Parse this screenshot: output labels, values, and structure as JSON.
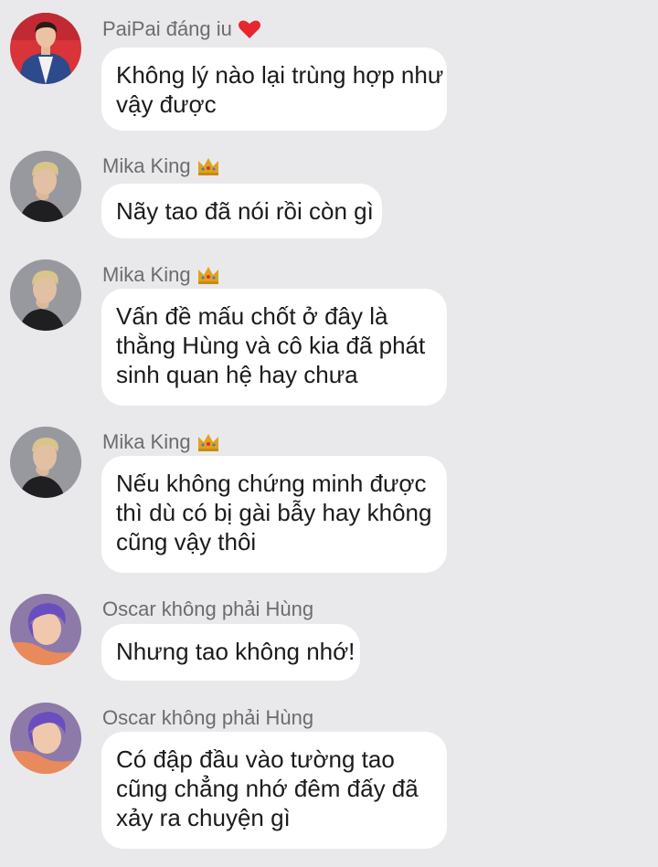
{
  "messages": [
    {
      "sender": "PaiPai đáng iu",
      "sender_icon": "heart-icon",
      "avatar": "avatar-red-jacket",
      "lines": [
        "Không lý nào lại trùng hợp như",
        "vậy được"
      ]
    },
    {
      "sender": "Mika King",
      "sender_icon": "crown-icon",
      "avatar": "avatar-blond-profile",
      "lines": [
        "Nãy tao đã nói rồi còn gì"
      ]
    },
    {
      "sender": "Mika King",
      "sender_icon": "crown-icon",
      "avatar": "avatar-blond-profile",
      "lines": [
        "Vấn đề mấu chốt ở đây là",
        "thằng Hùng và cô kia đã phát",
        "sinh quan hệ hay chưa"
      ]
    },
    {
      "sender": "Mika King",
      "sender_icon": "crown-icon",
      "avatar": "avatar-blond-profile",
      "lines": [
        "Nếu không chứng minh được",
        "thì dù có bị gài bẫy hay không",
        "cũng vậy thôi"
      ]
    },
    {
      "sender": "Oscar không phải Hùng",
      "avatar": "avatar-purple-hair",
      "lines": [
        "Nhưng tao không nhớ!"
      ]
    },
    {
      "sender": "Oscar không phải Hùng",
      "avatar": "avatar-purple-hair",
      "lines": [
        "Có đập đầu vào tường tao",
        "cũng chẳng nhớ đêm đấy đã",
        "xảy ra chuyện gì"
      ]
    }
  ],
  "colors": {
    "background": "#e9e9eb",
    "bubble": "#ffffff",
    "sender_text": "#6c6c70",
    "message_text": "#1b1b1b",
    "heart": "#e8262d",
    "crown": "#e0a21e"
  }
}
